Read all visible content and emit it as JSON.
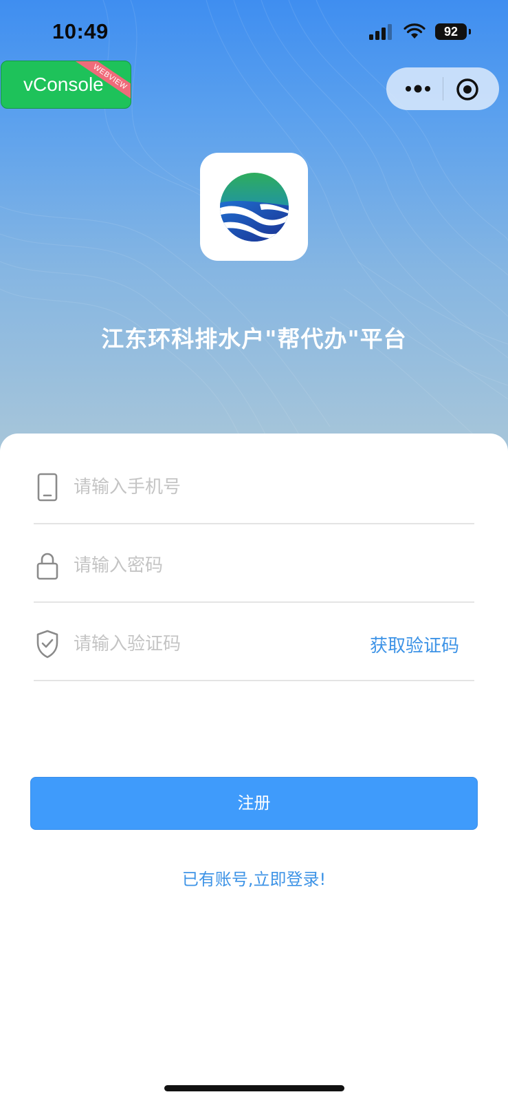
{
  "status_bar": {
    "time": "10:49",
    "battery": "92",
    "icons": [
      "signal-icon",
      "wifi-icon",
      "battery-icon"
    ]
  },
  "vconsole": {
    "label": "vConsole",
    "ribbon": "WEBVIEW"
  },
  "capsule": {
    "icons": [
      "more-icon",
      "close-target-icon"
    ]
  },
  "app": {
    "title": "江东环科排水户\"帮代办\"平台"
  },
  "form": {
    "phone_placeholder": "请输入手机号",
    "password_placeholder": "请输入密码",
    "code_placeholder": "请输入验证码",
    "get_code_label": "获取验证码",
    "register_label": "注册",
    "login_link": "已有账号,立即登录!"
  },
  "colors": {
    "accent": "#3f9bfb",
    "link": "#3d93e6",
    "vconsole_green": "#1ec25a",
    "hero_top": "#3f8ef0",
    "hero_bottom": "#a8c6d9"
  }
}
